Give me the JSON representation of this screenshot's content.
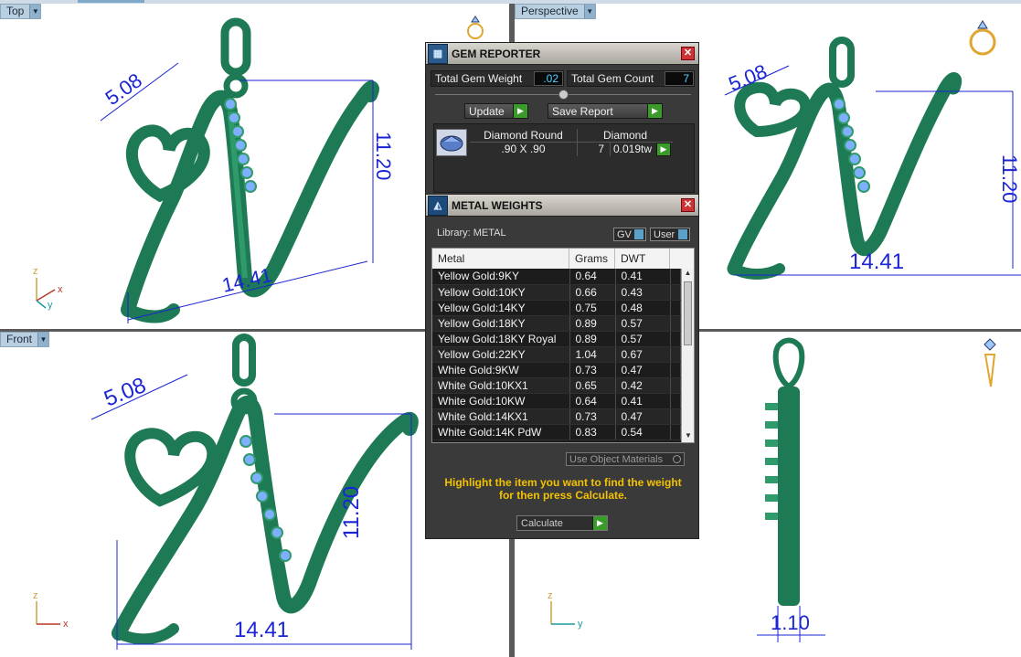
{
  "viewports": {
    "top": {
      "label": "Top"
    },
    "perspective": {
      "label": "Perspective"
    },
    "front": {
      "label": "Front"
    }
  },
  "dimensions": {
    "width": "14.41",
    "height": "11.20",
    "heart": "5.08",
    "thickness": "1.10"
  },
  "axes": {
    "x": "x",
    "y": "y",
    "z": "z"
  },
  "gem_reporter": {
    "title": "GEM REPORTER",
    "total_weight_label": "Total Gem Weight",
    "total_weight_value": ".02",
    "total_count_label": "Total Gem Count",
    "total_count_value": "7",
    "update_label": "Update",
    "save_report_label": "Save Report",
    "gem": {
      "shape": "Diamond Round",
      "type": "Diamond",
      "size": ".90 X .90",
      "count": "7",
      "weight": "0.019tw"
    }
  },
  "metal_weights": {
    "title": "METAL WEIGHTS",
    "library_label": "Library: METAL",
    "gv_label": "GV",
    "user_label": "User",
    "columns": [
      "Metal",
      "Grams",
      "DWT"
    ],
    "rows": [
      {
        "metal": "Yellow Gold:9KY",
        "grams": "0.64",
        "dwt": "0.41"
      },
      {
        "metal": "Yellow Gold:10KY",
        "grams": "0.66",
        "dwt": "0.43"
      },
      {
        "metal": "Yellow Gold:14KY",
        "grams": "0.75",
        "dwt": "0.48"
      },
      {
        "metal": "Yellow Gold:18KY",
        "grams": "0.89",
        "dwt": "0.57"
      },
      {
        "metal": "Yellow Gold:18KY Royal",
        "grams": "0.89",
        "dwt": "0.57"
      },
      {
        "metal": "Yellow Gold:22KY",
        "grams": "1.04",
        "dwt": "0.67"
      },
      {
        "metal": "White Gold:9KW",
        "grams": "0.73",
        "dwt": "0.47"
      },
      {
        "metal": "White Gold:10KX1",
        "grams": "0.65",
        "dwt": "0.42"
      },
      {
        "metal": "White Gold:10KW",
        "grams": "0.64",
        "dwt": "0.41"
      },
      {
        "metal": "White Gold:14KX1",
        "grams": "0.73",
        "dwt": "0.47"
      },
      {
        "metal": "White Gold:14K PdW",
        "grams": "0.83",
        "dwt": "0.54"
      }
    ],
    "use_object_materials_label": "Use Object Materials",
    "hint": "Highlight the item you want to find the weight for then press Calculate.",
    "calculate_label": "Calculate"
  },
  "colors": {
    "model": "#1e7a55",
    "dimension": "#1a24d4",
    "gem": "#7fb0ff",
    "hint": "#f2c200"
  }
}
